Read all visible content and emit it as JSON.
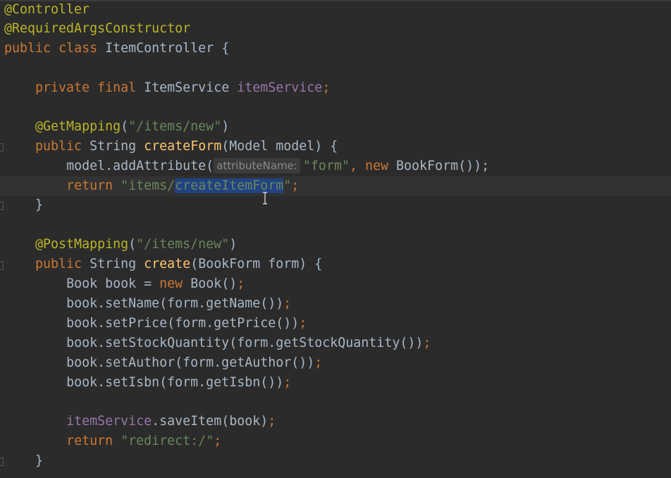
{
  "code": {
    "line1": {
      "annotation": "@Controller"
    },
    "line2": {
      "annotation": "@RequiredArgsConstructor"
    },
    "line3": {
      "kw1": "public",
      "kw2": "class",
      "name": "ItemController",
      "brace": "{"
    },
    "line5": {
      "kw1": "private",
      "kw2": "final",
      "type": "ItemService",
      "field": "itemService",
      "semi": ";"
    },
    "line7": {
      "annotation": "@GetMapping",
      "open": "(",
      "value": "\"/items/new\"",
      "close": ")"
    },
    "line8": {
      "kw": "public",
      "ret": "String",
      "method": "createForm",
      "params": "(Model model) {"
    },
    "line9": {
      "call": "model.addAttribute(",
      "hint": "attributeName:",
      "arg1": "\"form\"",
      "comma": ",",
      "kw": "new",
      "ctor": "BookForm());",
      "semi": ";"
    },
    "line10": {
      "kw": "return",
      "str_before": "\"items/",
      "str_selected": "createItemForm",
      "str_after": "\"",
      "semi": ";"
    },
    "line11": {
      "brace": "}"
    },
    "line13": {
      "annotation": "@PostMapping",
      "open": "(",
      "value": "\"/items/new\"",
      "close": ")"
    },
    "line14": {
      "kw": "public",
      "ret": "String",
      "method": "create",
      "params": "(BookForm form) {"
    },
    "line15": {
      "decl": "Book book = ",
      "kw": "new",
      "ctor": "Book()",
      "semi": ";"
    },
    "line16": {
      "text": "book.setName(form.getName())",
      "semi": ";"
    },
    "line17": {
      "text": "book.setPrice(form.getPrice())",
      "semi": ";"
    },
    "line18": {
      "text": "book.setStockQuantity(form.getStockQuantity())",
      "semi": ";"
    },
    "line19": {
      "text": "book.setAuthor(form.getAuthor())",
      "semi": ";"
    },
    "line20": {
      "text": "book.setIsbn(form.getIsbn())",
      "semi": ";"
    },
    "line22": {
      "field": "itemService",
      "call": ".saveItem(book)",
      "semi": ";"
    },
    "line23": {
      "kw": "return",
      "value": "\"redirect:/\"",
      "semi": ";"
    },
    "line24": {
      "brace": "}"
    }
  },
  "colors": {
    "background": "#2b2b2b",
    "annotation": "#bbb529",
    "keyword": "#cc7832",
    "field": "#9876aa",
    "method": "#ffc66d",
    "string": "#6a8759",
    "text": "#a9b7c6",
    "selection": "#214283"
  },
  "icons": {
    "cursor": "text-cursor-icon",
    "fold": "fold-marker-icon"
  }
}
